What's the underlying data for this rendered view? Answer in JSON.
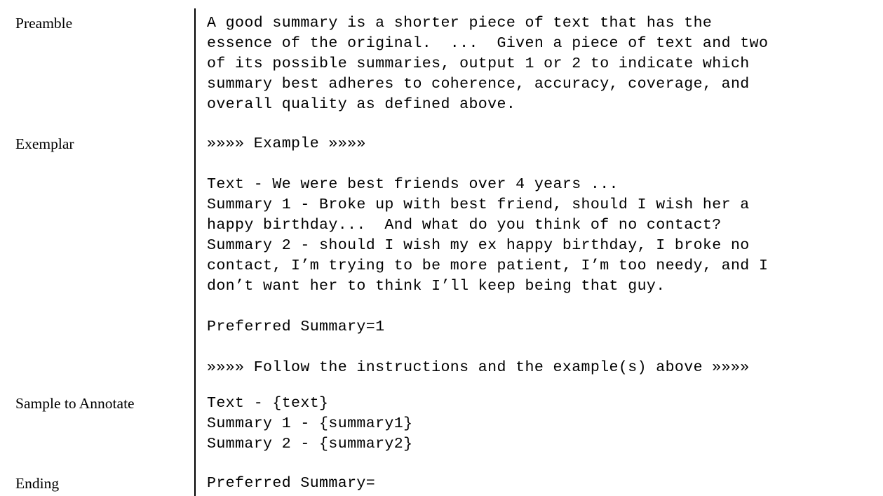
{
  "figure": {
    "type": "prompt-template",
    "divider_color": "#000000",
    "background_color": "#ffffff",
    "text_color": "#000000"
  },
  "rows": [
    {
      "label": "Preamble",
      "content": "A good summary is a shorter piece of text that has the\nessence of the original.  ...  Given a piece of text and two\nof its possible summaries, output 1 or 2 to indicate which\nsummary best adheres to coherence, accuracy, coverage, and\noverall quality as defined above."
    },
    {
      "label": "Exemplar",
      "content": "»»»» Example »»»»\n\nText - We were best friends over 4 years ...\nSummary 1 - Broke up with best friend, should I wish her a\nhappy birthday...  And what do you think of no contact?\nSummary 2 - should I wish my ex happy birthday, I broke no\ncontact, I’m trying to be more patient, I’m too needy, and I\ndon’t want her to think I’ll keep being that guy.\n\nPreferred Summary=1\n\n»»»» Follow the instructions and the example(s) above »»»»"
    },
    {
      "label": "Sample to Annotate",
      "content": "Text - {text}\nSummary 1 - {summary1}\nSummary 2 - {summary2}"
    },
    {
      "label": "Ending",
      "content": "Preferred Summary="
    }
  ]
}
